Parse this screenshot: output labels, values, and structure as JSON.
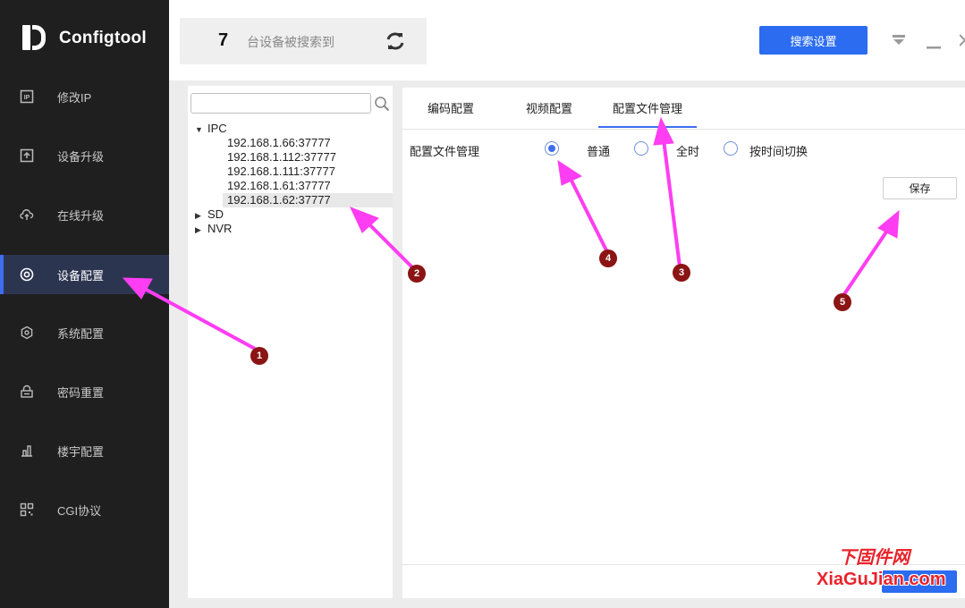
{
  "app": {
    "name": "Configtool"
  },
  "sidebar": {
    "items": [
      {
        "label": "修改IP",
        "icon": "ip-icon"
      },
      {
        "label": "设备升级",
        "icon": "upload-icon"
      },
      {
        "label": "在线升级",
        "icon": "cloud-upload-icon"
      },
      {
        "label": "设备配置",
        "icon": "target-icon",
        "active": true
      },
      {
        "label": "系统配置",
        "icon": "hexagon-settings-icon"
      },
      {
        "label": "密码重置",
        "icon": "lock-icon"
      },
      {
        "label": "楼宇配置",
        "icon": "building-icon"
      },
      {
        "label": "CGI协议",
        "icon": "qr-grid-icon"
      }
    ]
  },
  "header": {
    "device_count": "7",
    "device_count_text": "台设备被搜索到",
    "search_settings_label": "搜索设置"
  },
  "tree": {
    "search_placeholder": "",
    "groups": [
      {
        "label": "IPC",
        "expanded": true,
        "children": [
          "192.168.1.66:37777",
          "192.168.1.112:37777",
          "192.168.1.111:37777",
          "192.168.1.61:37777",
          "192.168.1.62:37777"
        ],
        "selected_index": 4
      },
      {
        "label": "SD",
        "expanded": false
      },
      {
        "label": "NVR",
        "expanded": false
      }
    ]
  },
  "main": {
    "tabs": [
      {
        "label": "编码配置"
      },
      {
        "label": "视频配置"
      },
      {
        "label": "配置文件管理",
        "active": true
      }
    ],
    "field_label": "配置文件管理",
    "options": [
      {
        "label": "普通",
        "checked": true
      },
      {
        "label": "全时",
        "checked": false
      },
      {
        "label": "按时间切换",
        "checked": false
      }
    ],
    "save_label": "保存"
  },
  "annotations": {
    "badges": [
      "1",
      "2",
      "3",
      "4",
      "5"
    ],
    "color": "#ff3df2"
  },
  "watermark": {
    "cn": "下固件网",
    "en": "XiaGuJian.com"
  },
  "colors": {
    "accent": "#2b6cf0",
    "sidebar_bg": "#1f1f1f",
    "badge": "#8b1414"
  }
}
